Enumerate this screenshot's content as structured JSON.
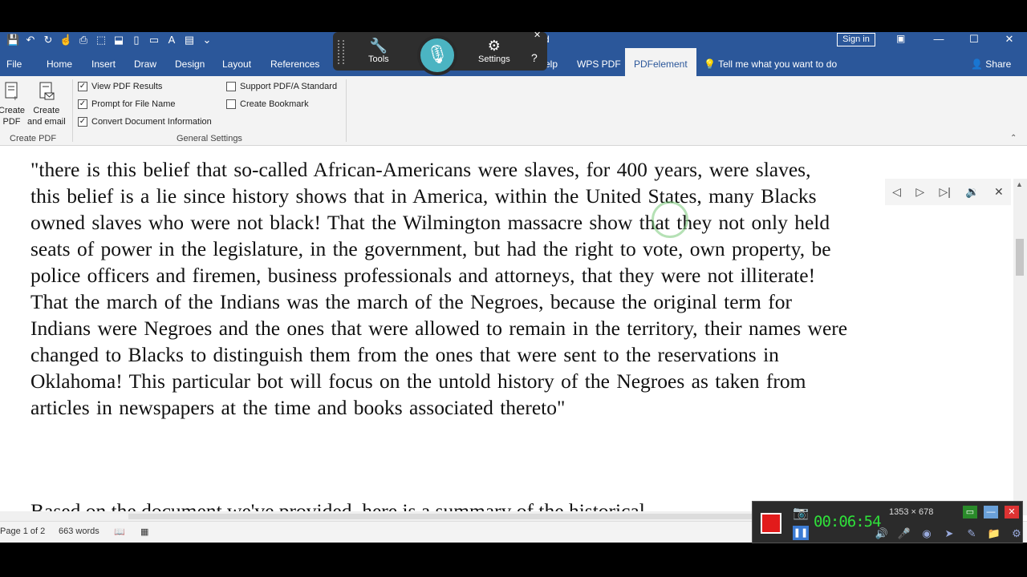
{
  "titlebar": {
    "title_fragment": "d",
    "signin_label": "Sign in",
    "qat_icons": [
      "save-icon",
      "undo-icon",
      "redo-icon",
      "touch-mode-icon",
      "print-preview-icon",
      "pdf-icon",
      "save-as-icon",
      "new-icon",
      "open-icon",
      "format-painter-icon",
      "clipboard-icon",
      "customize-icon"
    ]
  },
  "tabs": {
    "file": "File",
    "home": "Home",
    "insert": "Insert",
    "draw": "Draw",
    "design": "Design",
    "layout": "Layout",
    "references": "References",
    "help_fragment": "elp",
    "wps_pdf": "WPS PDF",
    "pdfelement": "PDFelement",
    "tell_me": "Tell me what you want to do",
    "share": "Share"
  },
  "ribbon": {
    "create_pdf_label": "Create PDF",
    "create_pdf_lines": [
      "Create",
      "PDF"
    ],
    "create_email_lines": [
      "Create",
      "and email"
    ],
    "group_create_pdf": "Create PDF",
    "group_general_settings": "General Settings",
    "checkboxes": [
      {
        "label": "View PDF Results",
        "checked": true
      },
      {
        "label": "Prompt for File Name",
        "checked": true
      },
      {
        "label": "Convert Document Information",
        "checked": true
      },
      {
        "label": "Support PDF/A Standard",
        "checked": false
      },
      {
        "label": "Create Bookmark",
        "checked": false
      }
    ]
  },
  "floating_toolbar": {
    "tools_label": "Tools",
    "settings_label": "Settings",
    "help_glyph": "?",
    "close_glyph": "✕"
  },
  "document": {
    "lines": [
      " \"there is this belief that so-called African-Americans were slaves, for 400 years, were slaves,",
      "this belief is a lie since history shows that in America, within the United States, many Blacks",
      "owned slaves who were not black! That the Wilmington massacre show that they not only held",
      "seats of power in the legislature, in the government, but had the right to vote, own property, be",
      "police officers and firemen, business professionals and attorneys, that they were not illiterate!",
      "That the march of the Indians was the march of the Negroes, because the original term for",
      "Indians were Negroes and the ones that were allowed to remain in the territory, their names were",
      "changed to Blacks to distinguish them from the ones that were sent to the reservations in",
      "Oklahoma! This particular bot will focus on the untold history of the Negroes as taken from",
      "articles in newspapers at the time and books associated thereto\""
    ],
    "partial_next_line": "Based on the document we've provided, here is a summary of the historical"
  },
  "status": {
    "page": "Page 1 of 2",
    "words": "663 words"
  },
  "recorder": {
    "timer": "00:06:54",
    "size": "1353 × 678",
    "record_color": "#e21b1b"
  }
}
